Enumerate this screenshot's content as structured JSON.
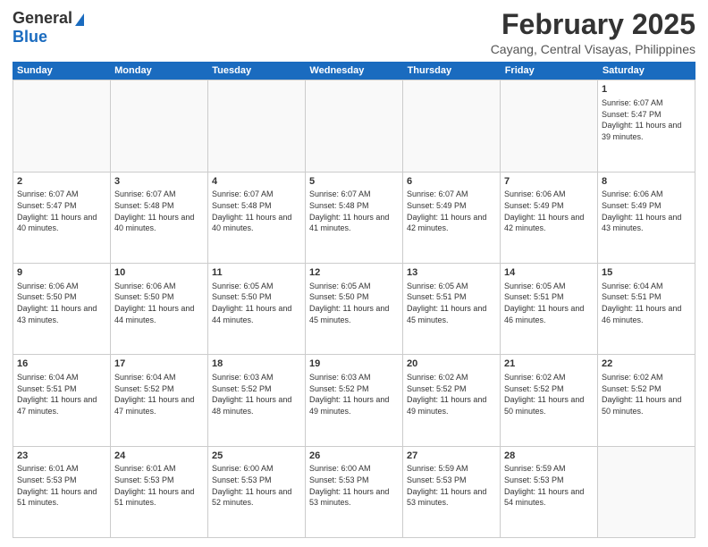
{
  "header": {
    "logo_general": "General",
    "logo_blue": "Blue",
    "month_title": "February 2025",
    "location": "Cayang, Central Visayas, Philippines"
  },
  "weekdays": [
    "Sunday",
    "Monday",
    "Tuesday",
    "Wednesday",
    "Thursday",
    "Friday",
    "Saturday"
  ],
  "weeks": [
    [
      {
        "day": "",
        "info": ""
      },
      {
        "day": "",
        "info": ""
      },
      {
        "day": "",
        "info": ""
      },
      {
        "day": "",
        "info": ""
      },
      {
        "day": "",
        "info": ""
      },
      {
        "day": "",
        "info": ""
      },
      {
        "day": "1",
        "info": "Sunrise: 6:07 AM\nSunset: 5:47 PM\nDaylight: 11 hours and 39 minutes."
      }
    ],
    [
      {
        "day": "2",
        "info": "Sunrise: 6:07 AM\nSunset: 5:47 PM\nDaylight: 11 hours and 40 minutes."
      },
      {
        "day": "3",
        "info": "Sunrise: 6:07 AM\nSunset: 5:48 PM\nDaylight: 11 hours and 40 minutes."
      },
      {
        "day": "4",
        "info": "Sunrise: 6:07 AM\nSunset: 5:48 PM\nDaylight: 11 hours and 40 minutes."
      },
      {
        "day": "5",
        "info": "Sunrise: 6:07 AM\nSunset: 5:48 PM\nDaylight: 11 hours and 41 minutes."
      },
      {
        "day": "6",
        "info": "Sunrise: 6:07 AM\nSunset: 5:49 PM\nDaylight: 11 hours and 42 minutes."
      },
      {
        "day": "7",
        "info": "Sunrise: 6:06 AM\nSunset: 5:49 PM\nDaylight: 11 hours and 42 minutes."
      },
      {
        "day": "8",
        "info": "Sunrise: 6:06 AM\nSunset: 5:49 PM\nDaylight: 11 hours and 43 minutes."
      }
    ],
    [
      {
        "day": "9",
        "info": "Sunrise: 6:06 AM\nSunset: 5:50 PM\nDaylight: 11 hours and 43 minutes."
      },
      {
        "day": "10",
        "info": "Sunrise: 6:06 AM\nSunset: 5:50 PM\nDaylight: 11 hours and 44 minutes."
      },
      {
        "day": "11",
        "info": "Sunrise: 6:05 AM\nSunset: 5:50 PM\nDaylight: 11 hours and 44 minutes."
      },
      {
        "day": "12",
        "info": "Sunrise: 6:05 AM\nSunset: 5:50 PM\nDaylight: 11 hours and 45 minutes."
      },
      {
        "day": "13",
        "info": "Sunrise: 6:05 AM\nSunset: 5:51 PM\nDaylight: 11 hours and 45 minutes."
      },
      {
        "day": "14",
        "info": "Sunrise: 6:05 AM\nSunset: 5:51 PM\nDaylight: 11 hours and 46 minutes."
      },
      {
        "day": "15",
        "info": "Sunrise: 6:04 AM\nSunset: 5:51 PM\nDaylight: 11 hours and 46 minutes."
      }
    ],
    [
      {
        "day": "16",
        "info": "Sunrise: 6:04 AM\nSunset: 5:51 PM\nDaylight: 11 hours and 47 minutes."
      },
      {
        "day": "17",
        "info": "Sunrise: 6:04 AM\nSunset: 5:52 PM\nDaylight: 11 hours and 47 minutes."
      },
      {
        "day": "18",
        "info": "Sunrise: 6:03 AM\nSunset: 5:52 PM\nDaylight: 11 hours and 48 minutes."
      },
      {
        "day": "19",
        "info": "Sunrise: 6:03 AM\nSunset: 5:52 PM\nDaylight: 11 hours and 49 minutes."
      },
      {
        "day": "20",
        "info": "Sunrise: 6:02 AM\nSunset: 5:52 PM\nDaylight: 11 hours and 49 minutes."
      },
      {
        "day": "21",
        "info": "Sunrise: 6:02 AM\nSunset: 5:52 PM\nDaylight: 11 hours and 50 minutes."
      },
      {
        "day": "22",
        "info": "Sunrise: 6:02 AM\nSunset: 5:52 PM\nDaylight: 11 hours and 50 minutes."
      }
    ],
    [
      {
        "day": "23",
        "info": "Sunrise: 6:01 AM\nSunset: 5:53 PM\nDaylight: 11 hours and 51 minutes."
      },
      {
        "day": "24",
        "info": "Sunrise: 6:01 AM\nSunset: 5:53 PM\nDaylight: 11 hours and 51 minutes."
      },
      {
        "day": "25",
        "info": "Sunrise: 6:00 AM\nSunset: 5:53 PM\nDaylight: 11 hours and 52 minutes."
      },
      {
        "day": "26",
        "info": "Sunrise: 6:00 AM\nSunset: 5:53 PM\nDaylight: 11 hours and 53 minutes."
      },
      {
        "day": "27",
        "info": "Sunrise: 5:59 AM\nSunset: 5:53 PM\nDaylight: 11 hours and 53 minutes."
      },
      {
        "day": "28",
        "info": "Sunrise: 5:59 AM\nSunset: 5:53 PM\nDaylight: 11 hours and 54 minutes."
      },
      {
        "day": "",
        "info": ""
      }
    ]
  ]
}
